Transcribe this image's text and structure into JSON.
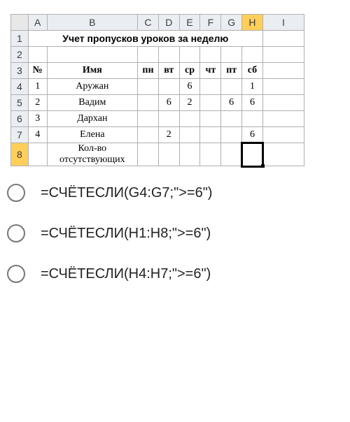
{
  "spreadsheet": {
    "columns": [
      "A",
      "B",
      "C",
      "D",
      "E",
      "F",
      "G",
      "H",
      "I"
    ],
    "rows": [
      "1",
      "2",
      "3",
      "4",
      "5",
      "6",
      "7",
      "8"
    ],
    "title": "Учет пропусков уроков за неделю",
    "header": {
      "num": "№",
      "name": "Имя",
      "days": [
        "пн",
        "вт",
        "ср",
        "чт",
        "пт",
        "сб"
      ]
    },
    "students": [
      {
        "n": "1",
        "name": "Аружан",
        "d": [
          "",
          "",
          "6",
          "",
          "",
          "1"
        ]
      },
      {
        "n": "2",
        "name": "Вадим",
        "d": [
          "",
          "6",
          "2",
          "",
          "6",
          "6"
        ]
      },
      {
        "n": "3",
        "name": "Дархан",
        "d": [
          "",
          "",
          "",
          "",
          "",
          ""
        ]
      },
      {
        "n": "4",
        "name": "Елена",
        "d": [
          "",
          "2",
          "",
          "",
          "",
          "6"
        ]
      }
    ],
    "footer_label_1": "Кол-во",
    "footer_label_2": "отсутствующих"
  },
  "answers": [
    "=СЧЁТЕСЛИ(G4:G7;\">=6\")",
    "=СЧЁТЕСЛИ(H1:H8;\">=6\")",
    "=СЧЁТЕСЛИ(H4:H7;\">=6\")"
  ]
}
